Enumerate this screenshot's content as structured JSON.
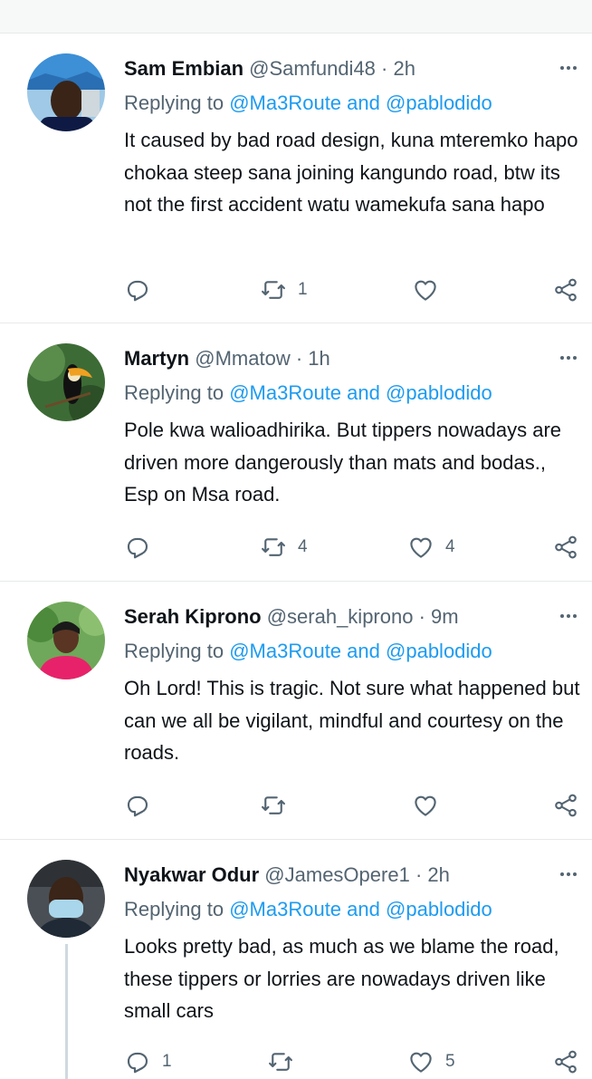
{
  "colors": {
    "link": "#1d9bf0",
    "muted": "#536471",
    "text": "#0f1419",
    "divider": "#e7e9ea"
  },
  "replies": [
    {
      "name": "Sam Embian",
      "handle": "@Samfundi48",
      "sep": "·",
      "time": "2h",
      "replying_label": "Replying to",
      "mention1": "@Ma3Route",
      "and": "and",
      "mention2": "@pablodido",
      "text": "It caused by bad road design, kuna mteremko hapo chokaa steep sana joining kangundo road, btw its not the first accident watu wamekufa sana hapo",
      "replies_count": "",
      "retweets_count": "1",
      "likes_count": ""
    },
    {
      "name": "Martyn",
      "handle": "@Mmatow",
      "sep": "·",
      "time": "1h",
      "replying_label": "Replying to",
      "mention1": "@Ma3Route",
      "and": "and",
      "mention2": "@pablodido",
      "text": "Pole kwa walioadhirika. But tippers nowadays are driven more dangerously than mats and bodas., Esp on Msa road.",
      "replies_count": "",
      "retweets_count": "4",
      "likes_count": "4"
    },
    {
      "name": "Serah Kiprono",
      "handle": "@serah_kiprono",
      "sep": "·",
      "time": "9m",
      "replying_label": "Replying to",
      "mention1": "@Ma3Route",
      "and": "and",
      "mention2": "@pablodido",
      "text": "Oh Lord! This is tragic. Not sure what happened but can we all be vigilant, mindful and courtesy on the roads.",
      "replies_count": "",
      "retweets_count": "",
      "likes_count": ""
    },
    {
      "name": "Nyakwar Odur",
      "handle": "@JamesOpere1",
      "sep": "·",
      "time": "2h",
      "replying_label": "Replying to",
      "mention1": "@Ma3Route",
      "and": "and",
      "mention2": "@pablodido",
      "text": "Looks pretty bad, as much as we blame the road, these tippers or lorries are nowadays driven like small cars",
      "replies_count": "1",
      "retweets_count": "",
      "likes_count": "5"
    }
  ],
  "icons": {
    "reply": "reply-icon",
    "retweet": "retweet-icon",
    "like": "heart-icon",
    "share": "share-icon",
    "more": "more-options-icon"
  }
}
